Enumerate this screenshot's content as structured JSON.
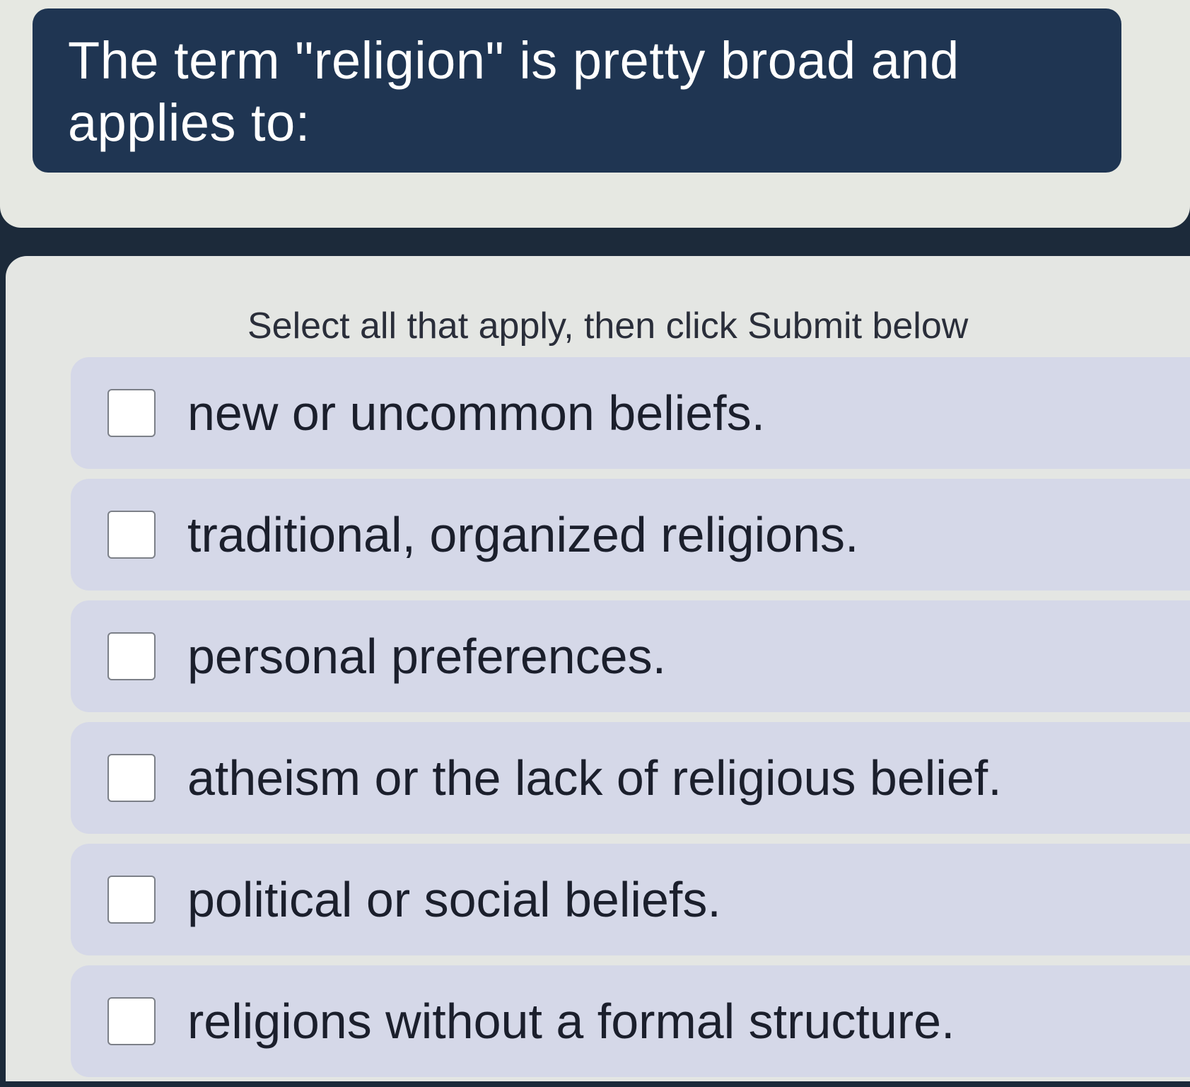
{
  "question": {
    "text": "The term \"religion\" is pretty broad and applies to:"
  },
  "instruction": "Select all that apply, then click Submit below",
  "options": [
    {
      "label": "new or uncommon beliefs.",
      "checked": false
    },
    {
      "label": "traditional, organized religions.",
      "checked": false
    },
    {
      "label": "personal preferences.",
      "checked": false
    },
    {
      "label": "atheism or the lack of religious belief.",
      "checked": false
    },
    {
      "label": "political or social beliefs.",
      "checked": false
    },
    {
      "label": "religions without a formal structure.",
      "checked": false
    }
  ],
  "colors": {
    "banner": "#1f3552",
    "option_background": "#d5d8e8",
    "text": "#1b1f2c"
  }
}
